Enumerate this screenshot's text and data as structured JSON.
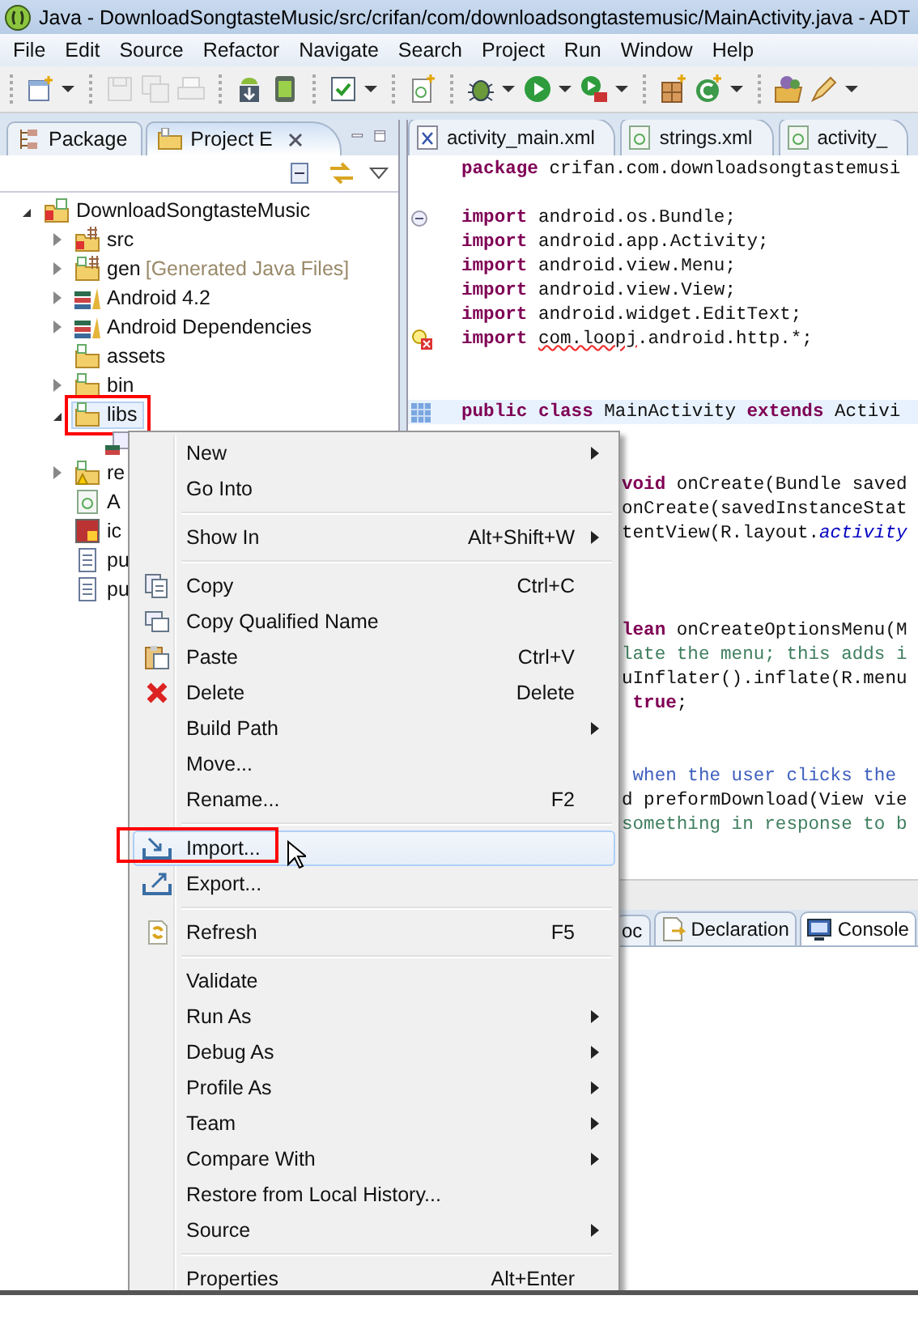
{
  "window": {
    "title": "Java - DownloadSongtasteMusic/src/crifan/com/downloadsongtastemusic/MainActivity.java - ADT"
  },
  "menu_bar": [
    "File",
    "Edit",
    "Source",
    "Refactor",
    "Navigate",
    "Search",
    "Project",
    "Run",
    "Window",
    "Help"
  ],
  "toolbar": [
    {
      "buttons": [
        {
          "kind": "new-wizard",
          "disabled": false,
          "dropdown": true
        }
      ]
    },
    {
      "buttons": [
        {
          "kind": "save",
          "disabled": true,
          "dropdown": false
        },
        {
          "kind": "save-all",
          "disabled": true,
          "dropdown": false
        },
        {
          "kind": "print",
          "disabled": true,
          "dropdown": false
        }
      ]
    },
    {
      "buttons": [
        {
          "kind": "sdk-manager",
          "disabled": false,
          "dropdown": false
        },
        {
          "kind": "device",
          "disabled": false,
          "dropdown": false
        }
      ]
    },
    {
      "buttons": [
        {
          "kind": "checkbox",
          "disabled": false,
          "dropdown": true
        }
      ]
    },
    {
      "buttons": [
        {
          "kind": "new-file",
          "disabled": false,
          "dropdown": false
        }
      ]
    },
    {
      "buttons": [
        {
          "kind": "bug",
          "disabled": false,
          "dropdown": true
        },
        {
          "kind": "run",
          "disabled": false,
          "dropdown": true
        },
        {
          "kind": "run-external",
          "disabled": false,
          "dropdown": true
        }
      ]
    },
    {
      "buttons": [
        {
          "kind": "grid",
          "disabled": false,
          "dropdown": false
        },
        {
          "kind": "new-class",
          "disabled": false,
          "dropdown": true
        }
      ]
    },
    {
      "buttons": [
        {
          "kind": "open-folder",
          "disabled": false,
          "dropdown": false
        },
        {
          "kind": "pen",
          "disabled": false,
          "dropdown": true
        }
      ]
    }
  ],
  "left_panel": {
    "tabs": [
      {
        "label": "Package",
        "selected": false,
        "closable": false
      },
      {
        "label": "Project E",
        "selected": true,
        "closable": true
      }
    ],
    "tree": [
      {
        "label": "DownloadSongtasteMusic",
        "kind": "project",
        "expanded": true,
        "selected": false,
        "children": [
          {
            "label": "src",
            "kind": "src-folder",
            "expanded": false,
            "selected": false
          },
          {
            "label": "gen",
            "decoration": "[Generated Java Files]",
            "kind": "gen-folder",
            "expanded": false,
            "selected": false
          },
          {
            "label": "Android 4.2",
            "kind": "library",
            "expanded": false,
            "selected": false
          },
          {
            "label": "Android Dependencies",
            "kind": "library",
            "expanded": false,
            "selected": false
          },
          {
            "label": "assets",
            "kind": "folder",
            "selected": false
          },
          {
            "label": "bin",
            "kind": "folder",
            "expanded": false,
            "selected": false
          },
          {
            "label": "libs",
            "kind": "folder",
            "expanded": true,
            "selected": true,
            "annotated": true,
            "children": [
              {
                "kind": "jar",
                "selected": false
              }
            ]
          },
          {
            "label": "re",
            "kind": "res-folder",
            "expanded": false,
            "selected": false
          },
          {
            "label": "A",
            "kind": "android-file",
            "selected": false
          },
          {
            "label": "ic",
            "kind": "image",
            "selected": false
          },
          {
            "label": "pu",
            "kind": "text-file",
            "selected": false
          },
          {
            "label": "pu",
            "kind": "text-file",
            "selected": false
          }
        ]
      }
    ]
  },
  "editor": {
    "tabs": [
      {
        "label": "activity_main.xml",
        "kind": "xml",
        "selected": false
      },
      {
        "label": "strings.xml",
        "kind": "android",
        "selected": false
      },
      {
        "label": "activity_",
        "kind": "android",
        "selected": false
      }
    ],
    "lines": [
      {
        "kind": "code",
        "tokens": [
          {
            "kind": "keyword",
            "text": "package"
          },
          {
            "kind": "plain",
            "text": " crifan.com.downloadsongtastemusi"
          }
        ]
      },
      {
        "kind": "blank"
      },
      {
        "kind": "code",
        "gutter": {
          "kind": "fold"
        },
        "tokens": [
          {
            "kind": "keyword",
            "text": "import"
          },
          {
            "kind": "plain",
            "text": " android.os.Bundle;"
          }
        ]
      },
      {
        "kind": "code",
        "tokens": [
          {
            "kind": "keyword",
            "text": "import"
          },
          {
            "kind": "plain",
            "text": " android.app.Activity;"
          }
        ]
      },
      {
        "kind": "code",
        "tokens": [
          {
            "kind": "keyword",
            "text": "import"
          },
          {
            "kind": "plain",
            "text": " android.view.Menu;"
          }
        ]
      },
      {
        "kind": "code",
        "tokens": [
          {
            "kind": "keyword",
            "text": "import"
          },
          {
            "kind": "plain",
            "text": " android.view.View;"
          }
        ]
      },
      {
        "kind": "code",
        "tokens": [
          {
            "kind": "keyword",
            "text": "import"
          },
          {
            "kind": "plain",
            "text": " android.widget.EditText;"
          }
        ]
      },
      {
        "kind": "code",
        "gutter": {
          "kind": "error"
        },
        "tokens": [
          {
            "kind": "keyword",
            "text": "import "
          },
          {
            "kind": "error",
            "text": "com.loopj"
          },
          {
            "kind": "plain",
            "text": ".android.http.*;"
          }
        ]
      },
      {
        "kind": "blank"
      },
      {
        "kind": "blank"
      },
      {
        "kind": "code",
        "gutter": {
          "kind": "marker"
        },
        "current": true,
        "tokens": [
          {
            "kind": "keyword",
            "text": "public class"
          },
          {
            "kind": "plain",
            "text": " MainActivity "
          },
          {
            "kind": "keyword",
            "text": "extends"
          },
          {
            "kind": "plain",
            "text": " Activi"
          }
        ]
      },
      {
        "kind": "blank"
      },
      {
        "kind": "blank"
      },
      {
        "kind": "partial",
        "tokens": [
          {
            "kind": "keyword",
            "text": "void"
          },
          {
            "kind": "plain",
            "text": " onCreate(Bundle saved"
          }
        ]
      },
      {
        "kind": "partial",
        "tokens": [
          {
            "kind": "plain",
            "text": "onCreate(savedInstanceStat"
          }
        ]
      },
      {
        "kind": "partial",
        "tokens": [
          {
            "kind": "plain",
            "text": "tentView(R.layout."
          },
          {
            "kind": "field",
            "text": "activity"
          }
        ]
      },
      {
        "kind": "blank"
      },
      {
        "kind": "blank"
      },
      {
        "kind": "blank"
      },
      {
        "kind": "partial",
        "tokens": [
          {
            "kind": "keyword",
            "text": "lean"
          },
          {
            "kind": "plain",
            "text": " onCreateOptionsMenu(M"
          }
        ]
      },
      {
        "kind": "partial",
        "tokens": [
          {
            "kind": "comment",
            "text": "late the menu; this adds i"
          }
        ]
      },
      {
        "kind": "partial",
        "tokens": [
          {
            "kind": "plain",
            "text": "uInflater().inflate(R.menu"
          }
        ]
      },
      {
        "kind": "partial",
        "tokens": [
          {
            "kind": "keyword",
            "text": " true"
          },
          {
            "kind": "plain",
            "text": ";"
          }
        ]
      },
      {
        "kind": "blank"
      },
      {
        "kind": "blank"
      },
      {
        "kind": "partial",
        "tokens": [
          {
            "kind": "doc",
            "text": " when the user clicks the"
          }
        ]
      },
      {
        "kind": "partial",
        "tokens": [
          {
            "kind": "plain",
            "text": "d preformDownload(View vie"
          }
        ]
      },
      {
        "kind": "partial",
        "tokens": [
          {
            "kind": "comment",
            "text": "something in response to b"
          }
        ]
      }
    ]
  },
  "bottom_panel": {
    "tabs": [
      {
        "label": "oc",
        "kind": "plain",
        "selected": false
      },
      {
        "label": "Declaration",
        "kind": "declaration",
        "selected": false
      },
      {
        "label": "Console",
        "kind": "console",
        "selected": true
      }
    ]
  },
  "context_menu": {
    "items": [
      {
        "kind": "plain",
        "label": "New",
        "submenu": true,
        "selected": false
      },
      {
        "kind": "plain",
        "label": "Go Into",
        "submenu": false,
        "selected": false
      },
      {
        "kind": "separator"
      },
      {
        "kind": "plain",
        "label": "Show In",
        "shortcut": "Alt+Shift+W",
        "submenu": true,
        "selected": false
      },
      {
        "kind": "separator"
      },
      {
        "kind": "copy",
        "label": "Copy",
        "shortcut": "Ctrl+C",
        "submenu": false,
        "selected": false
      },
      {
        "kind": "copy-name",
        "label": "Copy Qualified Name",
        "submenu": false,
        "selected": false
      },
      {
        "kind": "paste",
        "label": "Paste",
        "shortcut": "Ctrl+V",
        "submenu": false,
        "selected": false
      },
      {
        "kind": "delete",
        "label": "Delete",
        "shortcut": "Delete",
        "submenu": false,
        "selected": false
      },
      {
        "kind": "plain",
        "label": "Build Path",
        "submenu": true,
        "selected": false
      },
      {
        "kind": "plain",
        "label": "Move...",
        "submenu": false,
        "selected": false
      },
      {
        "kind": "plain",
        "label": "Rename...",
        "shortcut": "F2",
        "submenu": false,
        "selected": false
      },
      {
        "kind": "separator"
      },
      {
        "kind": "import",
        "label": "Import...",
        "submenu": false,
        "selected": true,
        "annotated": true
      },
      {
        "kind": "export",
        "label": "Export...",
        "submenu": false,
        "selected": false
      },
      {
        "kind": "separator"
      },
      {
        "kind": "refresh",
        "label": "Refresh",
        "shortcut": "F5",
        "submenu": false,
        "selected": false
      },
      {
        "kind": "separator"
      },
      {
        "kind": "plain",
        "label": "Validate",
        "submenu": false,
        "selected": false
      },
      {
        "kind": "plain",
        "label": "Run As",
        "submenu": true,
        "selected": false
      },
      {
        "kind": "plain",
        "label": "Debug As",
        "submenu": true,
        "selected": false
      },
      {
        "kind": "plain",
        "label": "Profile As",
        "submenu": true,
        "selected": false
      },
      {
        "kind": "plain",
        "label": "Team",
        "submenu": true,
        "selected": false
      },
      {
        "kind": "plain",
        "label": "Compare With",
        "submenu": true,
        "selected": false
      },
      {
        "kind": "plain",
        "label": "Restore from Local History...",
        "submenu": false,
        "selected": false
      },
      {
        "kind": "plain",
        "label": "Source",
        "submenu": true,
        "selected": false
      },
      {
        "kind": "separator"
      },
      {
        "kind": "plain",
        "label": "Properties",
        "shortcut": "Alt+Enter",
        "submenu": false,
        "selected": false
      }
    ]
  }
}
